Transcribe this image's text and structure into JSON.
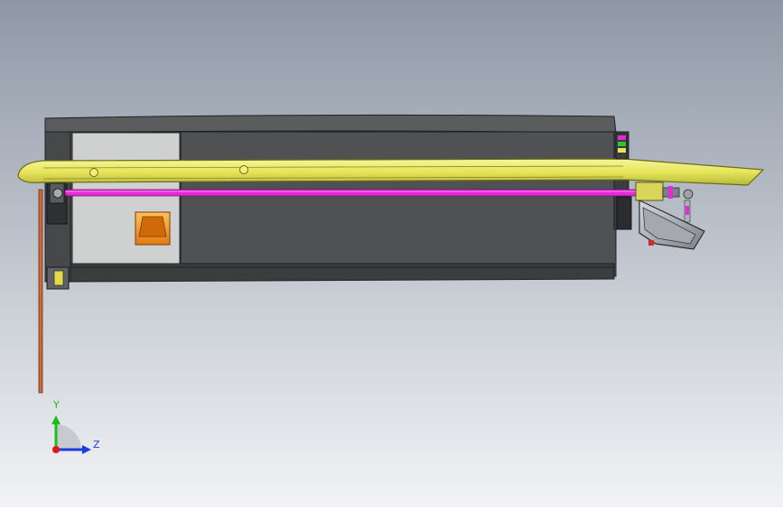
{
  "viewport": {
    "background_top": "#8e98a6",
    "background_bottom": "#f2f3f6"
  },
  "model": {
    "housing_color": "#4f5153",
    "housing_dark": "#2e3032",
    "panel_light_color": "#cfd0d0",
    "rail_color": "#eaea6a",
    "rail_edge_color": "#6d6a1c",
    "rod_color": "#e22ad8",
    "cup_color": "#f49a2a",
    "post_color": "#c86a3a",
    "bracket_color": "#8a8d90"
  },
  "triad": {
    "y_label": "Y",
    "z_label": "Z",
    "y_color": "#18c018",
    "z_color": "#1c3ce0",
    "x_color": "#e01818"
  }
}
